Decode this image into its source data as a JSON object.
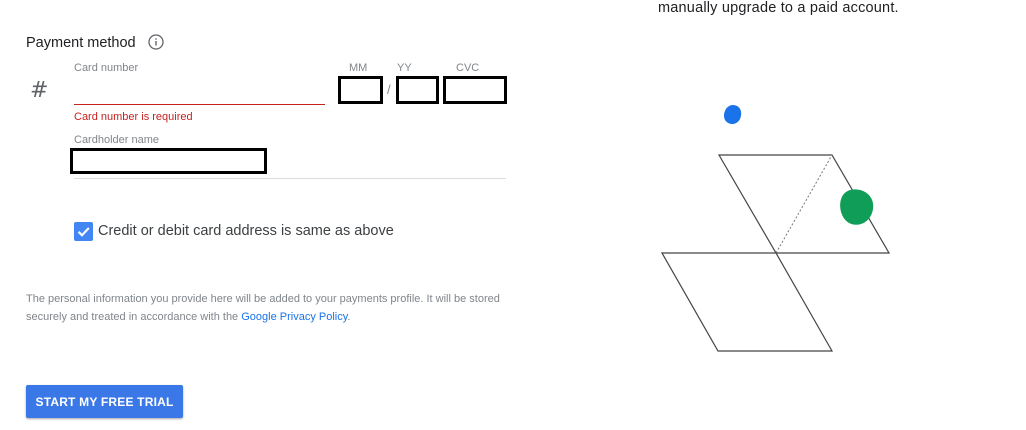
{
  "top_note": "manually upgrade to a paid account.",
  "payment": {
    "title": "Payment method",
    "info_icon": "info-icon",
    "card_icon": "#",
    "card_number_label": "Card number",
    "card_number_value": "",
    "card_number_error": "Card number is required",
    "mm_label": "MM",
    "yy_label": "YY",
    "cvc_label": "CVC",
    "date_separator": "/",
    "cardholder_label": "Cardholder name"
  },
  "address": {
    "checkbox_label": "Credit or debit card address is same as above",
    "checked": true
  },
  "disclaimer": {
    "text": "The personal information you provide here will be added to your payments profile. It will be stored securely and treated in accordance with the ",
    "link": "Google Privacy Policy",
    "end": "."
  },
  "cta": {
    "label": "START MY FREE TRIAL"
  },
  "colors": {
    "accent": "#3b78e7",
    "error": "#c5221f",
    "checkbox": "#4285f4",
    "blob_blue": "#1a73e8",
    "blob_green": "#0f9d58"
  }
}
